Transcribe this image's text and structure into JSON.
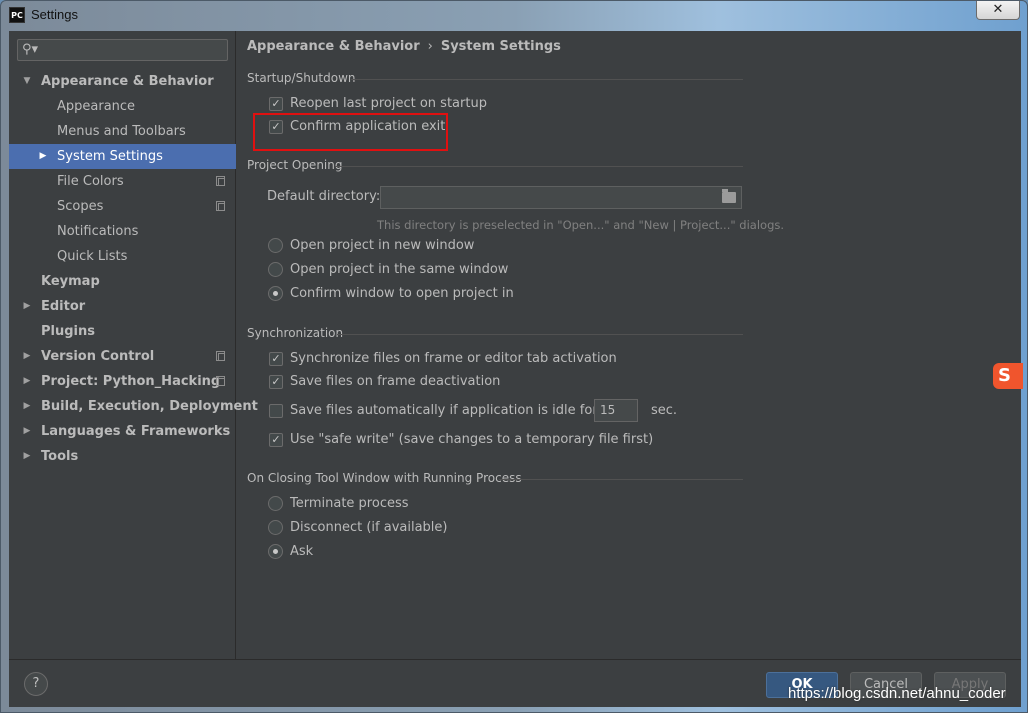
{
  "window": {
    "title": "Settings",
    "app_icon": "PC",
    "close_label": "✕"
  },
  "search": {
    "placeholder": ""
  },
  "sidebar": {
    "items": [
      {
        "label": "Appearance & Behavior",
        "level": 0,
        "expanded": true,
        "bold": true
      },
      {
        "label": "Appearance",
        "level": 1
      },
      {
        "label": "Menus and Toolbars",
        "level": 1
      },
      {
        "label": "System Settings",
        "level": 1,
        "selected": true,
        "collapsed": true
      },
      {
        "label": "File Colors",
        "level": 1,
        "copy_icon": true
      },
      {
        "label": "Scopes",
        "level": 1,
        "copy_icon": true
      },
      {
        "label": "Notifications",
        "level": 1
      },
      {
        "label": "Quick Lists",
        "level": 1
      },
      {
        "label": "Keymap",
        "level": 0,
        "bold": true
      },
      {
        "label": "Editor",
        "level": 0,
        "bold": true,
        "collapsed": true
      },
      {
        "label": "Plugins",
        "level": 0,
        "bold": true
      },
      {
        "label": "Version Control",
        "level": 0,
        "bold": true,
        "collapsed": true,
        "copy_icon": true
      },
      {
        "label": "Project: Python_Hacking",
        "level": 0,
        "bold": true,
        "collapsed": true,
        "copy_icon": true
      },
      {
        "label": "Build, Execution, Deployment",
        "level": 0,
        "bold": true,
        "collapsed": true
      },
      {
        "label": "Languages & Frameworks",
        "level": 0,
        "bold": true,
        "collapsed": true
      },
      {
        "label": "Tools",
        "level": 0,
        "bold": true,
        "collapsed": true
      }
    ]
  },
  "breadcrumb": {
    "parent": "Appearance & Behavior",
    "separator": "›",
    "current": "System Settings"
  },
  "startup": {
    "heading": "Startup/Shutdown",
    "reopen_label": "Reopen last project on startup",
    "reopen_checked": true,
    "confirm_exit_label": "Confirm application exit",
    "confirm_exit_checked": true
  },
  "project_opening": {
    "heading": "Project Opening",
    "default_dir_label": "Default directory:",
    "default_dir_value": "",
    "hint": "This directory is preselected in \"Open...\" and \"New | Project...\" dialogs.",
    "options": [
      "Open project in new window",
      "Open project in the same window",
      "Confirm window to open project in"
    ],
    "selected": "Confirm window to open project in"
  },
  "sync": {
    "heading": "Synchronization",
    "sync_files_label": "Synchronize files on frame or editor tab activation",
    "sync_files_checked": true,
    "save_deactivation_label": "Save files on frame deactivation",
    "save_deactivation_checked": true,
    "save_idle_label": "Save files automatically if application is idle for",
    "save_idle_checked": false,
    "idle_seconds": "15",
    "idle_unit": "sec.",
    "safe_write_label": "Use \"safe write\" (save changes to a temporary file first)",
    "safe_write_checked": true
  },
  "closing": {
    "heading": "On Closing Tool Window with Running Process",
    "options": [
      "Terminate process",
      "Disconnect (if available)",
      "Ask"
    ],
    "selected": "Ask"
  },
  "buttons": {
    "help": "?",
    "ok": "OK",
    "cancel": "Cancel",
    "apply": "Apply"
  },
  "watermark": "https://blog.csdn.net/ahnu_coder",
  "side_badge": "S",
  "colors": {
    "accent": "#4b6eaf",
    "highlight_box": "#e01010",
    "background": "#3c3f41"
  }
}
